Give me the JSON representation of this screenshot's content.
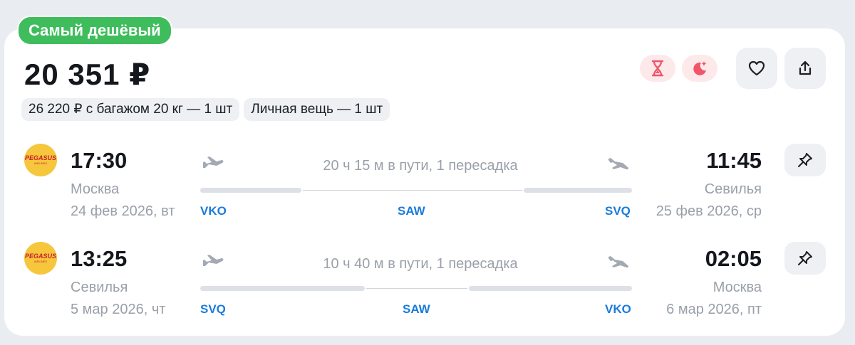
{
  "badge": "Самый дешёвый",
  "price": "20 351 ₽",
  "chips": [
    "26 220 ₽ с багажом 20 кг — 1 шт",
    "Личная вещь — 1 шт"
  ],
  "airline": {
    "name": "PEGASUS",
    "sub": "AIRLINES"
  },
  "feature_icons": [
    "hourglass-icon",
    "night-icon"
  ],
  "actions": [
    "heart-icon",
    "share-icon"
  ],
  "colors": {
    "badge": "#3fbd5c",
    "code": "#1a7bdc",
    "feature_bg": "#fde9ea",
    "feature_icon": "#f0556a"
  },
  "segments": [
    {
      "dep_time": "17:30",
      "dep_city": "Москва",
      "dep_date": "24 фев 2026, вт",
      "arr_time": "11:45",
      "arr_city": "Севилья",
      "arr_date": "25 фев 2026, ср",
      "duration": "20 ч 15 м в пути, 1 пересадка",
      "codes": [
        "VKO",
        "SAW",
        "SVQ"
      ]
    },
    {
      "dep_time": "13:25",
      "dep_city": "Севилья",
      "dep_date": "5 мар 2026, чт",
      "arr_time": "02:05",
      "arr_city": "Москва",
      "arr_date": "6 мар 2026, пт",
      "duration": "10 ч 40 м в пути, 1 пересадка",
      "codes": [
        "SVQ",
        "SAW",
        "VKO"
      ]
    }
  ]
}
